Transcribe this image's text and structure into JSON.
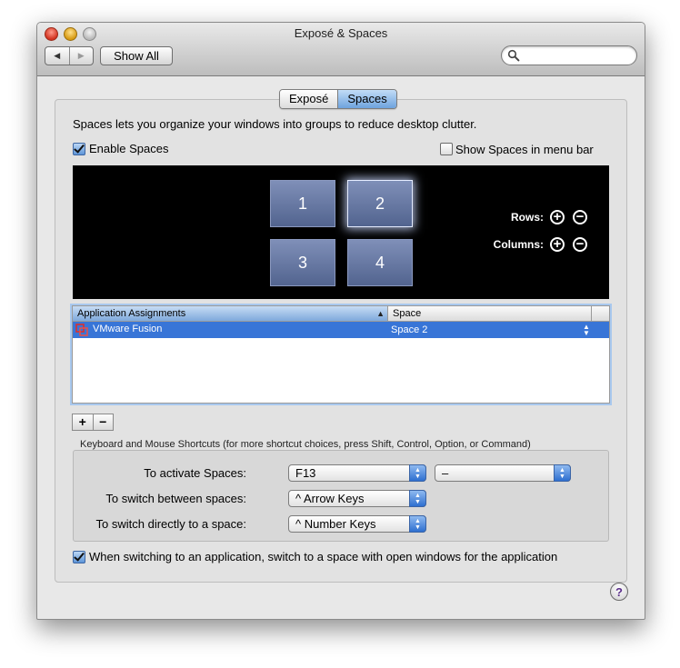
{
  "window": {
    "title": "Exposé & Spaces",
    "show_all_label": "Show All",
    "search": {
      "value": "",
      "placeholder": ""
    }
  },
  "nav": {
    "back_glyph": "◀",
    "forward_glyph": "▶"
  },
  "tabs": [
    {
      "label": "Exposé",
      "active": false
    },
    {
      "label": "Spaces",
      "active": true
    }
  ],
  "spaces": {
    "description": "Spaces lets you organize your windows into groups to reduce desktop clutter.",
    "enable_label": "Enable Spaces",
    "enable_checked": true,
    "menu_bar_label": "Show Spaces in menu bar",
    "menu_bar_checked": false,
    "grid": [
      {
        "label": "1",
        "selected": false
      },
      {
        "label": "2",
        "selected": true
      },
      {
        "label": "3",
        "selected": false
      },
      {
        "label": "4",
        "selected": false
      }
    ],
    "rows_label": "Rows:",
    "columns_label": "Columns:",
    "plus_glyph": "+",
    "minus_glyph": "−"
  },
  "assignments": {
    "columns": [
      "Application Assignments",
      "Space"
    ],
    "sort_glyph": "▲",
    "rows": [
      {
        "app": "VMware Fusion",
        "space": "Space 2",
        "selected": true
      }
    ],
    "add_label": "+",
    "remove_label": "−"
  },
  "shortcuts": {
    "title": "Keyboard and Mouse Shortcuts (for more shortcut choices, press Shift, Control, Option, or Command)",
    "activate_label": "To activate Spaces:",
    "activate_key": "F13",
    "activate_mouse": "–",
    "switch_between_label": "To switch between spaces:",
    "switch_between_value": "^ Arrow Keys",
    "switch_direct_label": "To switch directly to a space:",
    "switch_direct_value": "^ Number Keys"
  },
  "switching": {
    "label": "When switching to an application, switch to a space with open windows for the application",
    "checked": true
  },
  "help_label": "?",
  "colors": {
    "accent": "#3875d7",
    "preview_bg": "#000000",
    "space_tile": "#6b7ba6"
  }
}
